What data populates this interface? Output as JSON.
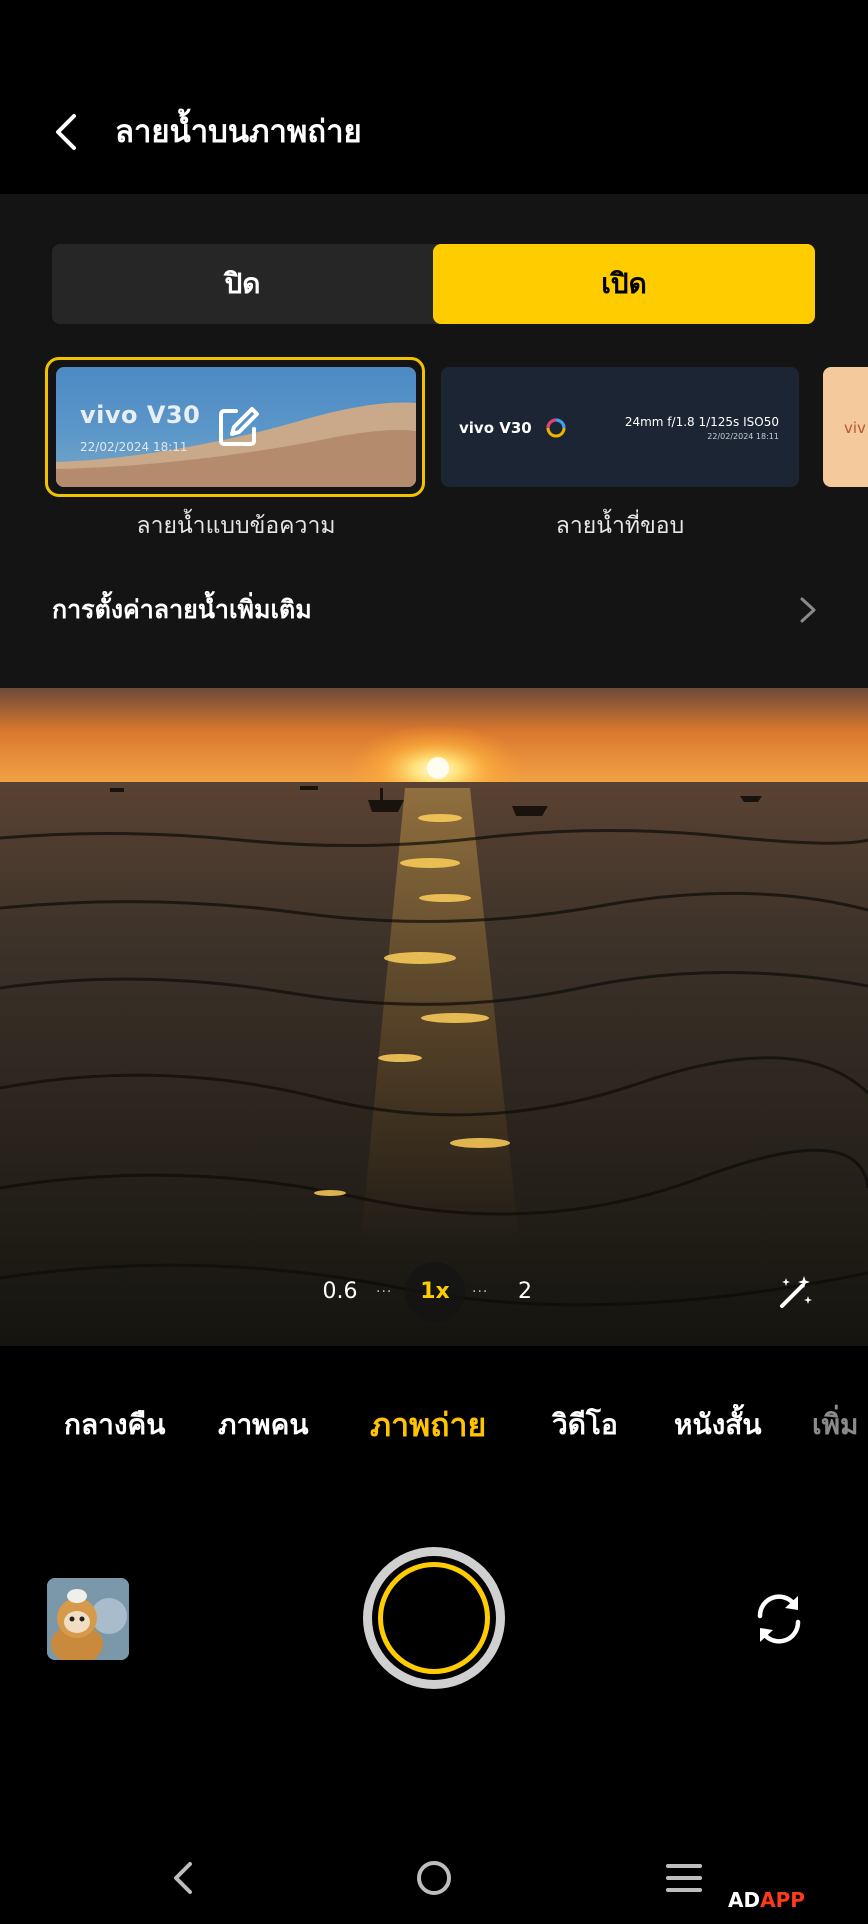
{
  "header": {
    "title": "ลายน้ำบนภาพถ่าย"
  },
  "toggle": {
    "off_label": "ปิด",
    "on_label": "เปิด",
    "selected": "on"
  },
  "cards": [
    {
      "label": "ลายน้ำแบบข้อความ",
      "brand": "vivo V30",
      "date": "22/02/2024 18:11",
      "selected": true
    },
    {
      "label": "ลายน้ำที่ขอบ",
      "brand": "vivo V30",
      "specs": "24mm f/1.8 1/125s ISO50",
      "date": "22/02/2024 18:11",
      "selected": false
    },
    {
      "partial_text": "viv"
    }
  ],
  "more_settings": {
    "label": "การตั้งค่าลายน้ำเพิ่มเติม"
  },
  "zoom": {
    "options": [
      "0.6",
      "1x",
      "2"
    ],
    "selected": "1x"
  },
  "modes": {
    "items": [
      "กลางคืน",
      "ภาพคน",
      "ภาพถ่าย",
      "วิดีโอ",
      "หนังสั้น",
      "เพิ่ม"
    ],
    "active": "ภาพถ่าย"
  },
  "watermark": {
    "text_a": "AD",
    "text_b": "APP"
  },
  "colors": {
    "accent": "#ffcc00",
    "panel": "#141414",
    "toggle_bg": "#262626"
  },
  "icons": [
    "back-icon",
    "edit-icon",
    "chevron-right-icon",
    "magic-wand-icon",
    "switch-camera-icon",
    "nav-back-icon",
    "nav-home-icon",
    "nav-menu-icon"
  ]
}
